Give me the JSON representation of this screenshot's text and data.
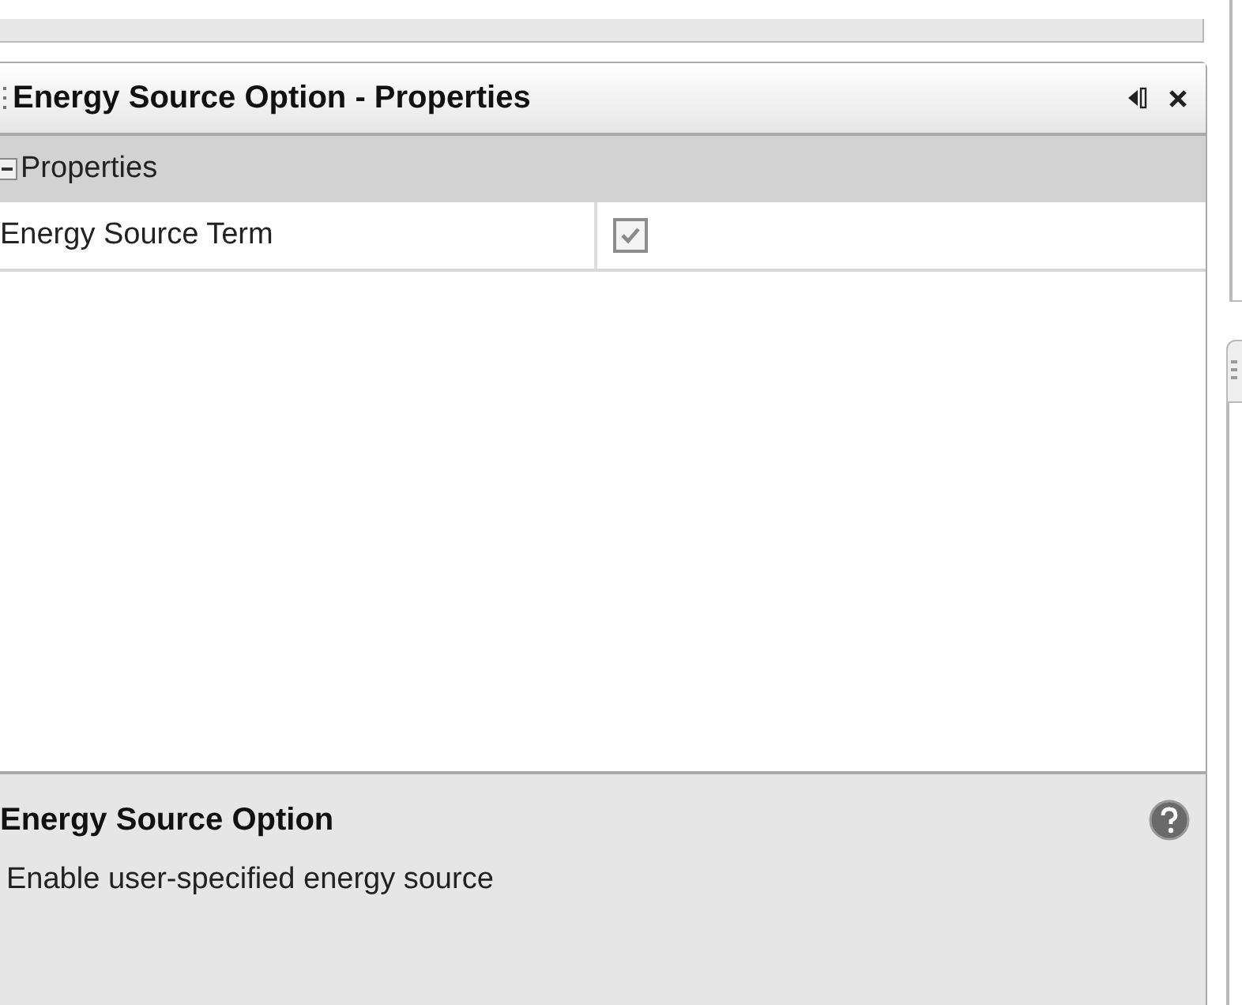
{
  "panel": {
    "title": "Energy Source Option - Properties"
  },
  "group": {
    "label": "Properties",
    "expanded": true
  },
  "properties": [
    {
      "name": "Energy Source Term",
      "kind": "checkbox",
      "checked": true
    }
  ],
  "help": {
    "title": "Energy Source Option",
    "description": "Enable user-specified energy source"
  }
}
